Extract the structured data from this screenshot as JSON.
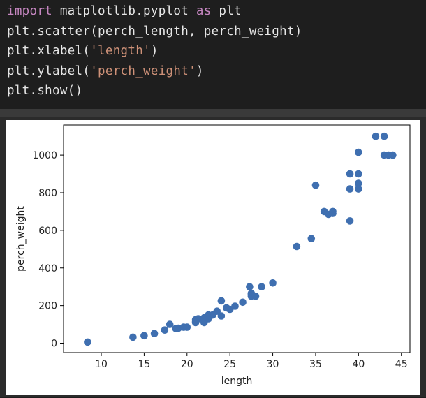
{
  "code": {
    "line1": {
      "kw1": "import",
      "rest1": " matplotlib.pyplot ",
      "kw2": "as",
      "rest2": " plt"
    },
    "line2": "plt.scatter(perch_length, perch_weight)",
    "line3": {
      "pre": "plt.xlabel(",
      "str": "'length'",
      "post": ")"
    },
    "line4": {
      "pre": "plt.ylabel(",
      "str": "'perch_weight'",
      "post": ")"
    },
    "line5": "plt.show()"
  },
  "colors": {
    "keyword": "#c586c0",
    "string": "#ce9178",
    "marker": "#3f6fb0"
  },
  "chart_data": {
    "type": "scatter",
    "title": "",
    "xlabel": "length",
    "ylabel": "perch_weight",
    "xlim": [
      5.6,
      46.0
    ],
    "ylim": [
      -50,
      1160
    ],
    "xticks": [
      10,
      15,
      20,
      25,
      30,
      35,
      40,
      45
    ],
    "yticks": [
      0,
      200,
      400,
      600,
      800,
      1000
    ],
    "grid": false,
    "points": [
      [
        8.4,
        5.9
      ],
      [
        13.7,
        32
      ],
      [
        15.0,
        40
      ],
      [
        16.2,
        51.5
      ],
      [
        17.4,
        70
      ],
      [
        18.0,
        100
      ],
      [
        18.7,
        78
      ],
      [
        19.0,
        80
      ],
      [
        19.6,
        85
      ],
      [
        20.0,
        85
      ],
      [
        21.0,
        110
      ],
      [
        21.0,
        115
      ],
      [
        21.0,
        125
      ],
      [
        21.3,
        130
      ],
      [
        22.0,
        120
      ],
      [
        22.0,
        120
      ],
      [
        22.0,
        130
      ],
      [
        22.0,
        135
      ],
      [
        22.0,
        110
      ],
      [
        22.5,
        130
      ],
      [
        22.5,
        150
      ],
      [
        22.7,
        145
      ],
      [
        23.0,
        150
      ],
      [
        23.5,
        170
      ],
      [
        24.0,
        225
      ],
      [
        24.0,
        145
      ],
      [
        24.6,
        188
      ],
      [
        25.0,
        180
      ],
      [
        25.6,
        197
      ],
      [
        26.5,
        218
      ],
      [
        27.3,
        300
      ],
      [
        27.5,
        260
      ],
      [
        27.5,
        265
      ],
      [
        27.5,
        250
      ],
      [
        28.0,
        250
      ],
      [
        28.7,
        300
      ],
      [
        30.0,
        320
      ],
      [
        32.8,
        514
      ],
      [
        34.5,
        556
      ],
      [
        35.0,
        840
      ],
      [
        36.5,
        685
      ],
      [
        36.0,
        700
      ],
      [
        37.0,
        700
      ],
      [
        37.0,
        690
      ],
      [
        39.0,
        900
      ],
      [
        39.0,
        650
      ],
      [
        39.0,
        820
      ],
      [
        40.0,
        850
      ],
      [
        40.0,
        900
      ],
      [
        40.0,
        1015
      ],
      [
        40.0,
        820
      ],
      [
        42.0,
        1100
      ],
      [
        43.0,
        1000
      ],
      [
        43.0,
        1100
      ],
      [
        43.5,
        1000
      ],
      [
        44.0,
        1000
      ]
    ]
  }
}
